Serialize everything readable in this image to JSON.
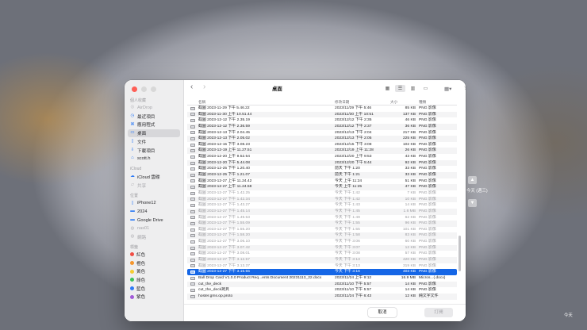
{
  "window": {
    "title": "桌面"
  },
  "sidebar": {
    "favorites_header": "個人收藏",
    "favorites": [
      {
        "label": "AirDrop",
        "icon": "airdrop-icon",
        "dim": true
      },
      {
        "label": "最近項目",
        "icon": "clock-icon"
      },
      {
        "label": "應用程式",
        "icon": "apps-icon"
      },
      {
        "label": "桌面",
        "icon": "desktop-icon",
        "selected": true
      },
      {
        "label": "文件",
        "icon": "doc-icon"
      },
      {
        "label": "下載項目",
        "icon": "download-icon"
      },
      {
        "label": "scott.h",
        "icon": "home-icon"
      }
    ],
    "icloud_header": "iCloud",
    "icloud": [
      {
        "label": "iCloud 雲碟",
        "icon": "cloud-icon"
      },
      {
        "label": "共享",
        "icon": "shared-folder-icon",
        "dim": true
      }
    ],
    "locations_header": "位置",
    "locations": [
      {
        "label": "iPhone12",
        "icon": "phone-icon"
      },
      {
        "label": "2024",
        "icon": "drive-icon"
      },
      {
        "label": "Google Drive",
        "icon": "drive-icon"
      },
      {
        "label": "nas01",
        "icon": "network-icon",
        "dim": true
      },
      {
        "label": "網路",
        "icon": "globe-icon",
        "dim": true
      }
    ],
    "tags_header": "標籤",
    "tags": [
      {
        "label": "紅色",
        "color": "#f14e45"
      },
      {
        "label": "橙色",
        "color": "#f5962d"
      },
      {
        "label": "黃色",
        "color": "#f4cc32"
      },
      {
        "label": "綠色",
        "color": "#3cc25a"
      },
      {
        "label": "藍色",
        "color": "#2f7cf6"
      },
      {
        "label": "紫色",
        "color": "#a25bd8"
      }
    ]
  },
  "toolbar": {
    "back": "‹",
    "forward": "›",
    "views": [
      "▦",
      "☰",
      "▥",
      "▭"
    ],
    "group": "▦▾",
    "share": "⇪",
    "tag": "◇",
    "more": "⋯▾",
    "search": "⌕"
  },
  "columns": {
    "name": "名稱",
    "date": "修改日期",
    "size": "大小",
    "kind": "種類"
  },
  "files": [
    {
      "name": "截圖 2023-11-29 下午 5.46.22",
      "date": "2023/11/29 下午 5:46",
      "size": "85 KB",
      "kind": "PNG 影像",
      "dim": false
    },
    {
      "name": "截圖 2023-11-30 上午 10.51.44",
      "date": "2023/11/30 上午 10:51",
      "size": "137 KB",
      "kind": "PNG 影像",
      "dim": false
    },
    {
      "name": "截圖 2023-12-12 下午 2.35.19",
      "date": "2023/12/12 下午 2:35",
      "size": "46 KB",
      "kind": "PNG 影像",
      "dim": false
    },
    {
      "name": "截圖 2023-12-12 下午 2.36.59",
      "date": "2023/12/12 下午 2:37",
      "size": "36 KB",
      "kind": "PNG 影像",
      "dim": false
    },
    {
      "name": "截圖 2023-12-13 下午 2.04.45",
      "date": "2023/12/13 下午 2:04",
      "size": "217 KB",
      "kind": "PNG 影像",
      "dim": false
    },
    {
      "name": "截圖 2023-12-13 下午 2.05.02",
      "date": "2023/12/13 下午 2:05",
      "size": "225 KB",
      "kind": "PNG 影像",
      "dim": false
    },
    {
      "name": "截圖 2023-12-15 下午 3.08.23",
      "date": "2023/12/15 下午 3:08",
      "size": "102 KB",
      "kind": "PNG 影像",
      "dim": false
    },
    {
      "name": "截圖 2023-12-19 上午 11.27.51",
      "date": "2023/12/19 上午 11:28",
      "size": "26 KB",
      "kind": "PNG 影像",
      "dim": false
    },
    {
      "name": "截圖 2023-12-20 上午 9.52.54",
      "date": "2023/12/20 上午 9:53",
      "size": "43 KB",
      "kind": "PNG 影像",
      "dim": false
    },
    {
      "name": "截圖 2023-12-20 下午 5.44.08",
      "date": "2023/12/20 下午 5:44",
      "size": "92 KB",
      "kind": "PNG 影像",
      "dim": false
    },
    {
      "name": "截圖 2023-12-25 下午 1.20.40",
      "date": "前天 下午 1:20",
      "size": "33 KB",
      "kind": "PNG 影像",
      "dim": false
    },
    {
      "name": "截圖 2023-12-25 下午 1.21.07",
      "date": "前天 下午 1:21",
      "size": "33 KB",
      "kind": "PNG 影像",
      "dim": false
    },
    {
      "name": "截圖 2023-12-27 上午 11.24.42",
      "date": "今天 上午 11:24",
      "size": "51 KB",
      "kind": "PNG 影像",
      "dim": false
    },
    {
      "name": "截圖 2023-12-27 上午 11.24.58",
      "date": "今天 上午 11:25",
      "size": "47 KB",
      "kind": "PNG 影像",
      "dim": false
    },
    {
      "name": "截圖 2023-12-27 下午 1.42.25",
      "date": "今天 下午 1:42",
      "size": "7 KB",
      "kind": "PNG 影像",
      "dim": true
    },
    {
      "name": "截圖 2023-12-27 下午 1.42.34",
      "date": "今天 下午 1:42",
      "size": "10 KB",
      "kind": "PNG 影像",
      "dim": true
    },
    {
      "name": "截圖 2023-12-27 下午 1.43.27",
      "date": "今天 下午 1:43",
      "size": "14 KB",
      "kind": "PNG 影像",
      "dim": true
    },
    {
      "name": "截圖 2023-12-27 下午 1.45.14",
      "date": "今天 下午 1:45",
      "size": "1.6 MB",
      "kind": "PNG 影像",
      "dim": true
    },
    {
      "name": "截圖 2023-12-27 下午 1.49.53",
      "date": "今天 下午 1:49",
      "size": "62 KB",
      "kind": "PNG 影像",
      "dim": true
    },
    {
      "name": "截圖 2023-12-27 下午 1.55.09",
      "date": "今天 下午 1:55",
      "size": "96 KB",
      "kind": "PNG 影像",
      "dim": true
    },
    {
      "name": "截圖 2023-12-27 下午 1.55.20",
      "date": "今天 下午 1:55",
      "size": "101 KB",
      "kind": "PNG 影像",
      "dim": true
    },
    {
      "name": "截圖 2023-12-27 下午 1.58.20",
      "date": "今天 下午 1:58",
      "size": "83 KB",
      "kind": "PNG 影像",
      "dim": true
    },
    {
      "name": "截圖 2023-12-27 下午 3.06.10",
      "date": "今天 下午 3:06",
      "size": "60 KB",
      "kind": "PNG 影像",
      "dim": true
    },
    {
      "name": "截圖 2023-12-27 下午 3.07.42",
      "date": "今天 下午 3:07",
      "size": "12 KB",
      "kind": "PNG 影像",
      "dim": true
    },
    {
      "name": "截圖 2023-12-27 下午 3.08.01",
      "date": "今天 下午 3:08",
      "size": "57 KB",
      "kind": "PNG 影像",
      "dim": true
    },
    {
      "name": "截圖 2023-12-27 下午 3.12.57",
      "date": "今天 下午 3:13",
      "size": "420 KB",
      "kind": "PNG 影像",
      "dim": true
    },
    {
      "name": "截圖 2023-12-27 下午 3.13.37",
      "date": "今天 下午 3:13",
      "size": "319 KB",
      "kind": "PNG 影像",
      "dim": true
    },
    {
      "name": "截圖 2023-12-27 下午 3.15.55",
      "date": "今天 下午 3:16",
      "size": "403 KB",
      "kind": "PNG 影像",
      "dim": false,
      "selected": true
    },
    {
      "name": "Ball Drop Card V1.0.0 Product Req...ents Document 20231113_22.docx",
      "date": "2023/11/24 上午 9:12",
      "size": "16.9 MB",
      "kind": "Micros...(.docx)",
      "dim": false
    },
    {
      "name": "cut_the_deck",
      "date": "2023/11/10 下午 5:57",
      "size": "14 KB",
      "kind": "PNG 影像",
      "dim": false
    },
    {
      "name": "cut_the_deck拷貝",
      "date": "2023/11/10 下午 5:57",
      "size": "14 KB",
      "kind": "PNG 影像",
      "dim": false
    },
    {
      "name": "hoster.gms.op.proto",
      "date": "2023/11/24 下午 6:43",
      "size": "12 KB",
      "kind": "純文字文件",
      "dim": false
    }
  ],
  "buttons": {
    "cancel": "取消",
    "open": "打開"
  },
  "desktop": {
    "today_label": "今天 (週三)",
    "corner_label": "今天"
  }
}
